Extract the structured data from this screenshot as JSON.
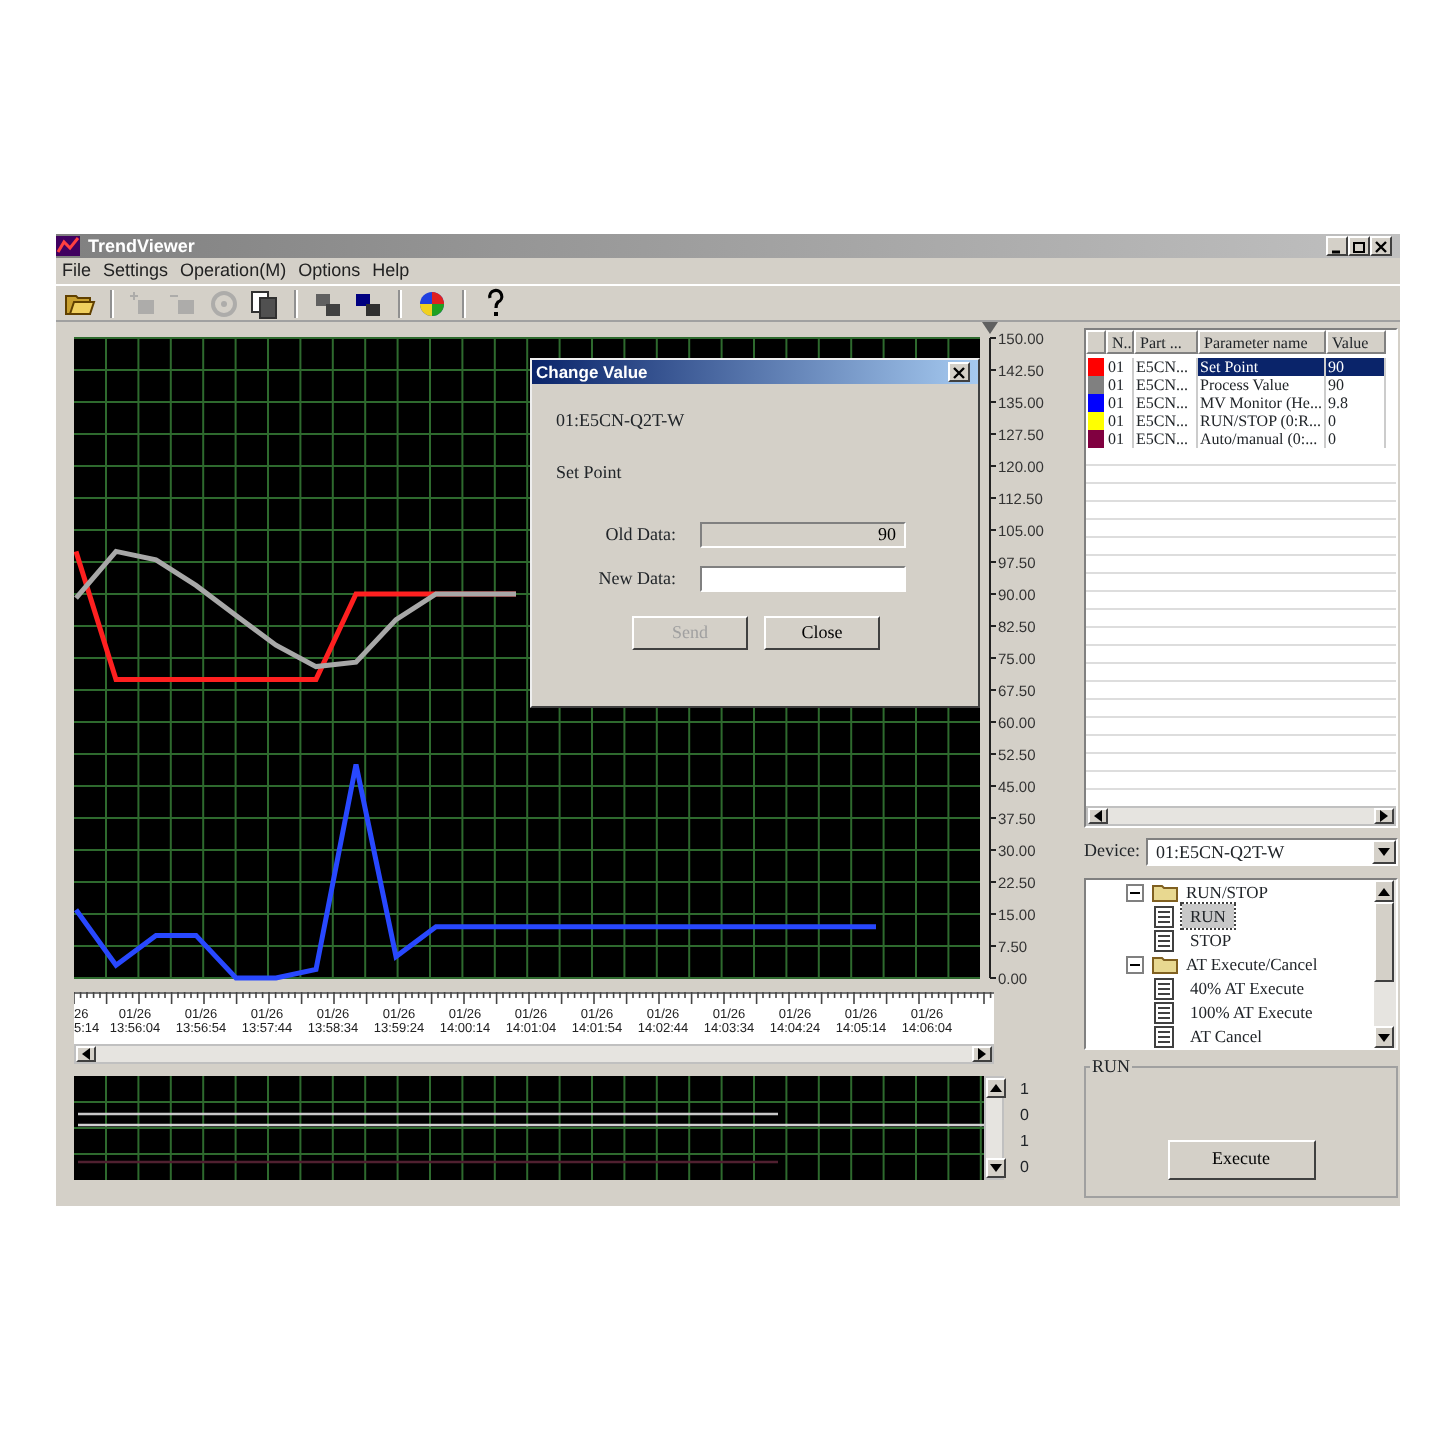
{
  "window": {
    "title": "TrendViewer"
  },
  "menu": [
    "File",
    "Settings",
    "Operation(M)",
    "Options",
    "Help"
  ],
  "toolbar": [
    {
      "kind": "open",
      "disabled": false
    },
    {
      "kind": "add",
      "disabled": true
    },
    {
      "kind": "remove",
      "disabled": true
    },
    {
      "kind": "record",
      "disabled": true
    },
    {
      "kind": "copy",
      "disabled": false
    },
    {
      "kind": "tile",
      "disabled": false
    },
    {
      "kind": "cascade",
      "disabled": false
    },
    {
      "kind": "color",
      "disabled": false
    },
    {
      "kind": "help",
      "disabled": false
    }
  ],
  "chart": {
    "chart_data": {
      "type": "line",
      "grid": true,
      "ylim": [
        0,
        150
      ],
      "yticks": [
        {
          "value": 150,
          "label": "150.00"
        },
        {
          "value": 142.5,
          "label": "142.50"
        },
        {
          "value": 135,
          "label": "135.00"
        },
        {
          "value": 127.5,
          "label": "127.50"
        },
        {
          "value": 120,
          "label": "120.00"
        },
        {
          "value": 112.5,
          "label": "112.50"
        },
        {
          "value": 105,
          "label": "105.00"
        },
        {
          "value": 97.5,
          "label": "97.50"
        },
        {
          "value": 90,
          "label": "90.00"
        },
        {
          "value": 82.5,
          "label": "82.50"
        },
        {
          "value": 75,
          "label": "75.00"
        },
        {
          "value": 67.5,
          "label": "67.50"
        },
        {
          "value": 60,
          "label": "60.00"
        },
        {
          "value": 52.5,
          "label": "52.50"
        },
        {
          "value": 45,
          "label": "45.00"
        },
        {
          "value": 37.5,
          "label": "37.50"
        },
        {
          "value": 30,
          "label": "30.00"
        },
        {
          "value": 22.5,
          "label": "22.50"
        },
        {
          "value": 15,
          "label": "15.00"
        },
        {
          "value": 7.5,
          "label": "7.50"
        },
        {
          "value": 0,
          "label": "0.00"
        }
      ],
      "series": [
        {
          "color": "#ff2020",
          "values": [
            100,
            70,
            70,
            70,
            70,
            70,
            70,
            90,
            90,
            90,
            90,
            90,
            null,
            null,
            null,
            null,
            null,
            null,
            null,
            null,
            null,
            null
          ]
        },
        {
          "color": "#a8a8a8",
          "values": [
            89,
            100,
            98,
            92,
            85,
            78,
            73,
            74,
            84,
            90,
            90,
            90,
            null,
            null,
            null,
            null,
            null,
            null,
            null,
            null,
            null,
            null
          ]
        },
        {
          "color": "#2848ff",
          "values": [
            16,
            3,
            10,
            10,
            0,
            0,
            2,
            50,
            5,
            12,
            12,
            12,
            12,
            12,
            12,
            12,
            12,
            12,
            12,
            12,
            12,
            null
          ]
        }
      ]
    }
  },
  "time_axis": {
    "labels": [
      {
        "date": "26",
        "time": "5:14"
      },
      {
        "date": "01/26",
        "time": "13:56:04"
      },
      {
        "date": "01/26",
        "time": "13:56:54"
      },
      {
        "date": "01/26",
        "time": "13:57:44"
      },
      {
        "date": "01/26",
        "time": "13:58:34"
      },
      {
        "date": "01/26",
        "time": "13:59:24"
      },
      {
        "date": "01/26",
        "time": "14:00:14"
      },
      {
        "date": "01/26",
        "time": "14:01:04"
      },
      {
        "date": "01/26",
        "time": "14:01:54"
      },
      {
        "date": "01/26",
        "time": "14:02:44"
      },
      {
        "date": "01/26",
        "time": "14:03:34"
      },
      {
        "date": "01/26",
        "time": "14:04:24"
      },
      {
        "date": "01/26",
        "time": "14:05:14"
      },
      {
        "date": "01/26",
        "time": "14:06:04"
      }
    ]
  },
  "sub_chart": {
    "labels": [
      "1",
      "0",
      "1",
      "0"
    ]
  },
  "dialog": {
    "title": "Change Value",
    "device": "01:E5CN-Q2T-W",
    "parameter": "Set Point",
    "fields": [
      {
        "label": "Old Data:",
        "value": "90",
        "disabled": true
      },
      {
        "label": "New Data:",
        "disabled": false
      }
    ],
    "buttons": [
      {
        "label": "Send",
        "disabled": true
      },
      {
        "label": "Close",
        "disabled": false
      }
    ]
  },
  "table": {
    "columns": [
      "N..",
      "Part ...",
      "Parameter name",
      "Value"
    ],
    "rows": [
      {
        "color": "#ff0000",
        "no": "01",
        "part": "E5CN...",
        "parameter": "Set Point",
        "value": "90",
        "selected": true
      },
      {
        "color": "#808080",
        "no": "01",
        "part": "E5CN...",
        "parameter": "Process Value",
        "value": "90",
        "selected": false
      },
      {
        "color": "#0000ff",
        "no": "01",
        "part": "E5CN...",
        "parameter": "MV Monitor (He...",
        "value": "9.8",
        "selected": false
      },
      {
        "color": "#ffff00",
        "no": "01",
        "part": "E5CN...",
        "parameter": "RUN/STOP (0:R...",
        "value": "0",
        "selected": false
      },
      {
        "color": "#800040",
        "no": "01",
        "part": "E5CN...",
        "parameter": "Auto/manual (0:...",
        "value": "0",
        "selected": false
      }
    ]
  },
  "device": {
    "label": "Device:",
    "value": "01:E5CN-Q2T-W"
  },
  "tree": [
    {
      "label": "RUN/STOP",
      "expanded": true,
      "selected": false,
      "children": [
        {
          "label": "RUN",
          "selected": true
        },
        {
          "label": "STOP",
          "selected": false
        }
      ]
    },
    {
      "label": "AT Execute/Cancel",
      "expanded": true,
      "selected": false,
      "children": [
        {
          "label": "40% AT Execute",
          "selected": false
        },
        {
          "label": "100% AT Execute",
          "selected": false
        },
        {
          "label": "AT Cancel",
          "selected": false
        }
      ]
    }
  ],
  "run_group": {
    "title": "RUN",
    "button": "Execute"
  }
}
